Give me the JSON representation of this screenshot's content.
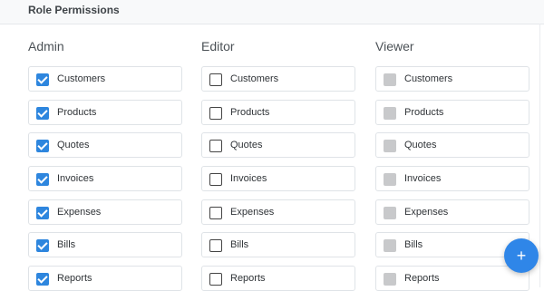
{
  "header": {
    "title": "Role Permissions"
  },
  "columns": [
    {
      "title": "Admin",
      "state": "checked",
      "items": [
        "Customers",
        "Products",
        "Quotes",
        "Invoices",
        "Expenses",
        "Bills",
        "Reports"
      ]
    },
    {
      "title": "Editor",
      "state": "unchecked",
      "items": [
        "Customers",
        "Products",
        "Quotes",
        "Invoices",
        "Expenses",
        "Bills",
        "Reports"
      ]
    },
    {
      "title": "Viewer",
      "state": "disabled",
      "items": [
        "Customers",
        "Products",
        "Quotes",
        "Invoices",
        "Expenses",
        "Bills",
        "Reports"
      ]
    }
  ],
  "fab": {
    "icon": "plus-icon",
    "glyph": "+"
  },
  "colors": {
    "accent": "#2e86de",
    "disabled": "#c8c9cb"
  }
}
